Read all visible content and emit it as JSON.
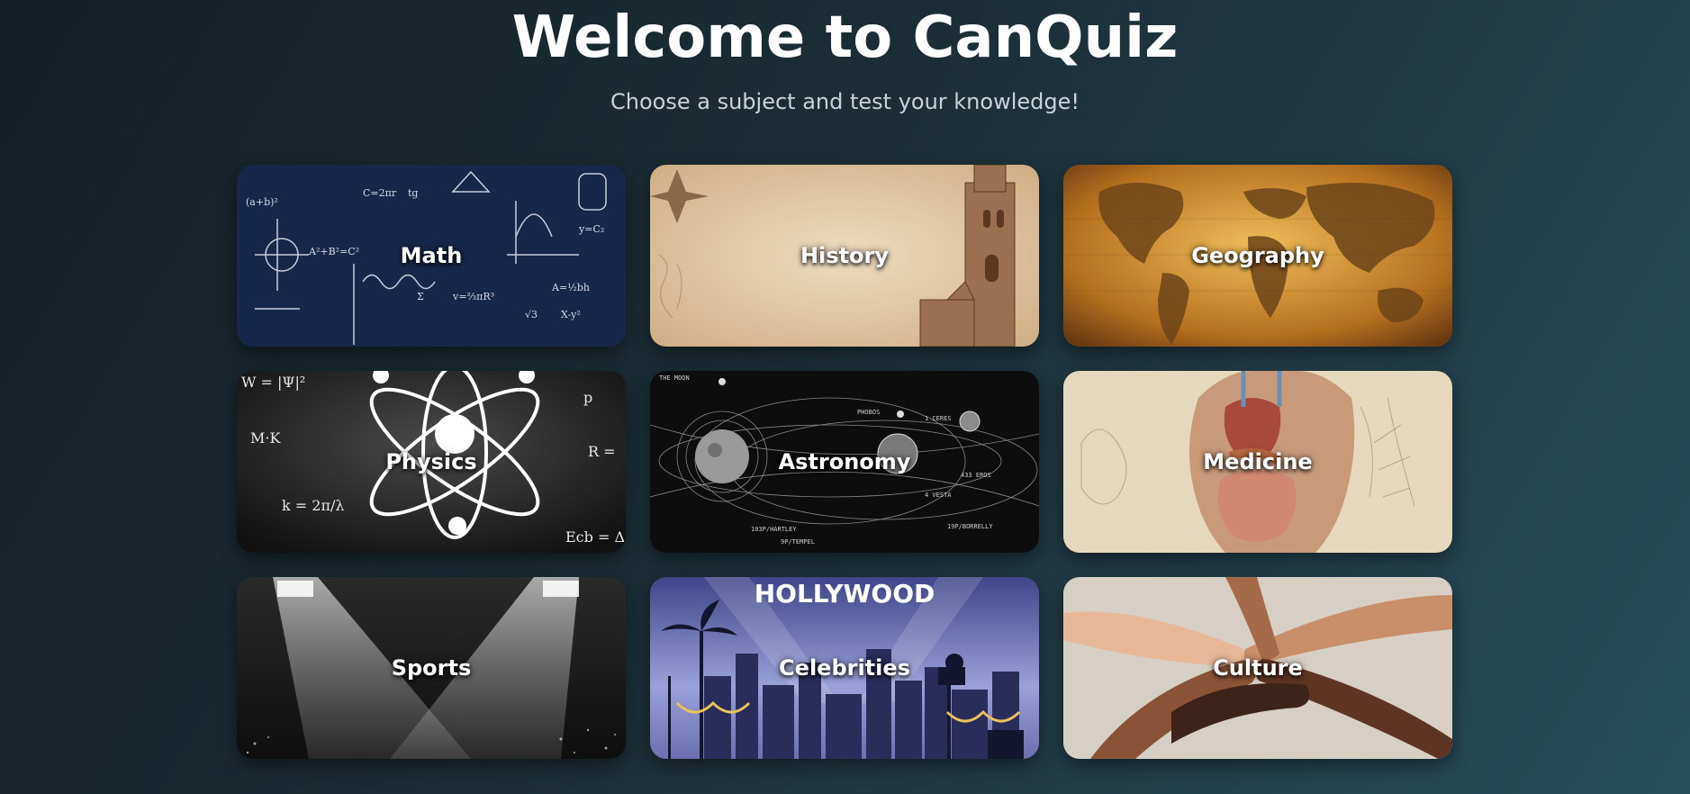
{
  "header": {
    "title": "Welcome to CanQuiz",
    "subtitle": "Choose a subject and test your knowledge!"
  },
  "subjects": [
    {
      "label": "Math",
      "image": "math-formulas-image"
    },
    {
      "label": "History",
      "image": "history-parchment-image"
    },
    {
      "label": "Geography",
      "image": "world-map-image"
    },
    {
      "label": "Physics",
      "image": "atom-physics-image"
    },
    {
      "label": "Astronomy",
      "image": "solar-system-image"
    },
    {
      "label": "Medicine",
      "image": "anatomy-image"
    },
    {
      "label": "Sports",
      "image": "stadium-lights-image"
    },
    {
      "label": "Celebrities",
      "image": "hollywood-skyline-image"
    },
    {
      "label": "Culture",
      "image": "stacked-hands-image"
    }
  ],
  "card_image_text": {
    "math": [
      "A²+B²=C²",
      "A=½bh",
      "X-y²",
      "√3",
      "C=2πr",
      "tg",
      "Σ",
      "v=⅔πR³",
      "y=C₂",
      "(a+b)²"
    ],
    "physics": [
      "W = |Ψ|²",
      "p",
      "R =",
      "M·K",
      "k = 2π/λ",
      "Ecb = Δ"
    ],
    "astronomy": [
      "THE MOON",
      "PHOBOS",
      "1 CERES",
      "433 EROS",
      "4 VESTA",
      "103P/HARTLEY",
      "9P/TEMPEL",
      "19P/BORRELLY"
    ],
    "celebrities": [
      "HOLLYWOOD"
    ]
  }
}
